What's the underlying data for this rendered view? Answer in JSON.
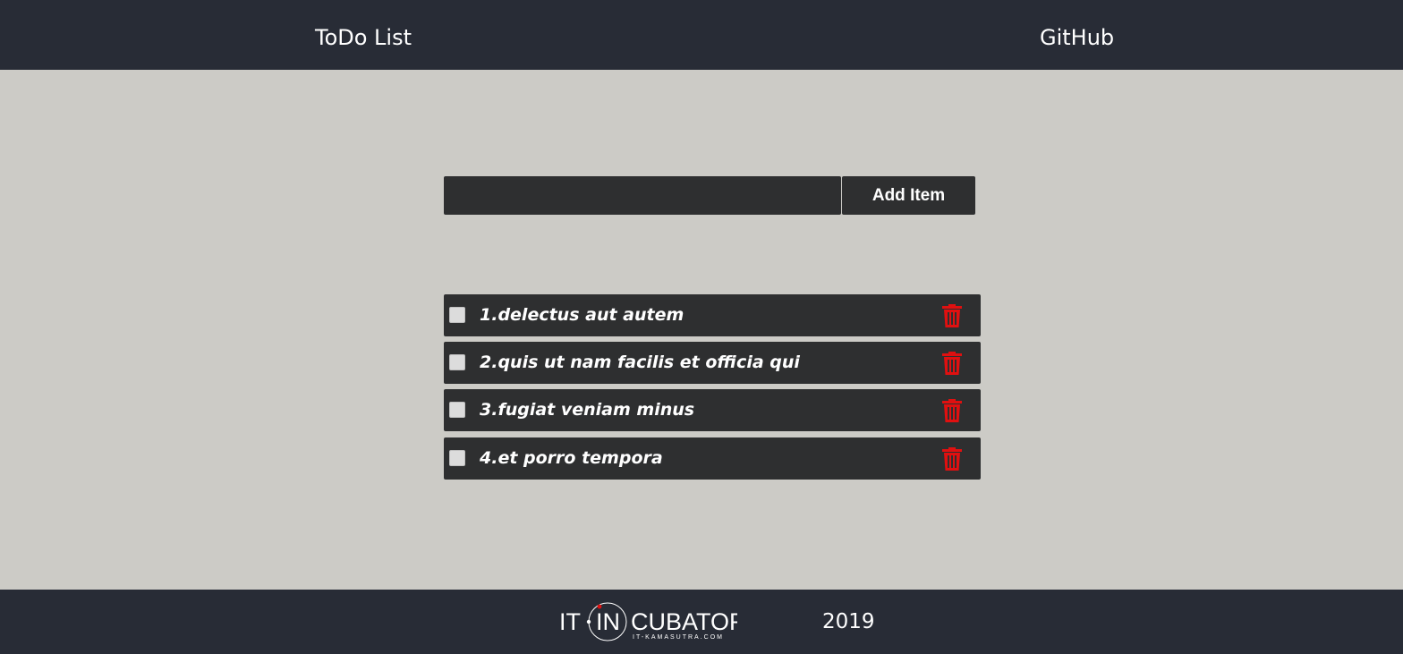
{
  "header": {
    "nav": [
      {
        "label": "ToDo List"
      },
      {
        "label": "GitHub"
      }
    ]
  },
  "add_form": {
    "input_value": "",
    "button_label": "Add Item"
  },
  "todos": [
    {
      "text": "1.delectus aut autem",
      "checked": false
    },
    {
      "text": "2.quis ut nam facilis et officia qui",
      "checked": false
    },
    {
      "text": "3.fugiat veniam minus",
      "checked": false
    },
    {
      "text": "4.et porro tempora",
      "checked": false
    }
  ],
  "todo_icons": {
    "delete": "trash-icon"
  },
  "footer": {
    "logo": {
      "wordmark": "IT·INCUBATOR",
      "tagline": "IT-KAMASUTRA.COM"
    },
    "year": "2019"
  },
  "colors": {
    "header_bg": "#282c36",
    "page_bg": "#cccbc6",
    "item_bg": "#2e2f30",
    "delete_icon": "#e01010"
  }
}
